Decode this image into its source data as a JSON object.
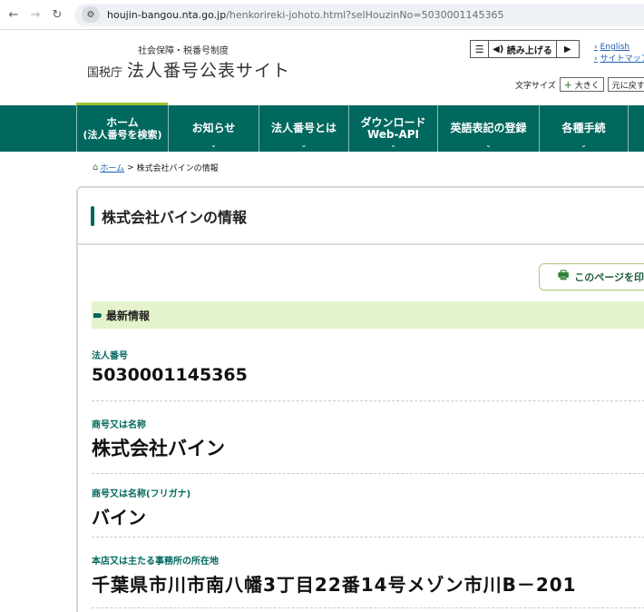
{
  "browser": {
    "url_domain": "houjin-bangou.nta.go.jp",
    "url_path": "/henkorireki-johoto.html?selHouzinNo=5030001145365"
  },
  "header": {
    "logo_sub": "社会保障・税番号制度",
    "logo_agency": "国税庁",
    "logo_title": "法人番号公表サイト",
    "tts_label": "読み上げる",
    "lang_english": "English",
    "lang_sitemap": "サイトマップ",
    "fontsize_label": "文字サイズ",
    "fontsize_large": "大きく",
    "fontsize_reset": "元に戻す"
  },
  "nav": {
    "items": [
      {
        "line1": "ホーム",
        "line2": "(法人番号を検索)"
      },
      {
        "line1": "お知らせ"
      },
      {
        "line1": "法人番号とは"
      },
      {
        "line1": "ダウンロード",
        "line2": "Web-API"
      },
      {
        "line1": "英語表記の登録"
      },
      {
        "line1": "各種手続"
      }
    ]
  },
  "breadcrumb": {
    "home": "ホーム",
    "current": "株式会社バインの情報"
  },
  "panel": {
    "title": "株式会社バインの情報",
    "print_label": "このページを印刷",
    "section_title": "最新情報"
  },
  "fields": {
    "corp_number_label": "法人番号",
    "corp_number_value": "5030001145365",
    "name_label": "商号又は名称",
    "name_value": "株式会社バイン",
    "furigana_label": "商号又は名称(フリガナ)",
    "furigana_value": "バイン",
    "address_label": "本店又は主たる事務所の所在地",
    "address_value": "千葉県市川市南八幡3丁目22番14号メゾン市川B－201"
  },
  "colors": {
    "nav_bg": "#00685e",
    "accent_green": "#9cc32e",
    "section_bg": "#e5f3cc"
  }
}
